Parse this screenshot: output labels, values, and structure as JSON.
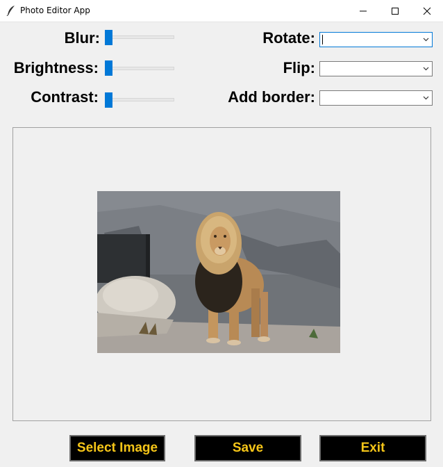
{
  "window": {
    "title": "Photo Editor App",
    "icons": {
      "app": "feather-icon",
      "minimize": "minimize-icon",
      "maximize": "maximize-icon",
      "close": "close-icon"
    }
  },
  "sliders": [
    {
      "label": "Blur:",
      "value": 0
    },
    {
      "label": "Brightness:",
      "value": 0
    },
    {
      "label": "Contrast:",
      "value": 0
    }
  ],
  "combos": [
    {
      "label": "Rotate:",
      "value": ""
    },
    {
      "label": "Flip:",
      "value": ""
    },
    {
      "label": "Add border:",
      "value": ""
    }
  ],
  "image": {
    "subject": "lion-photo"
  },
  "buttons": {
    "select_image": "Select Image",
    "save": "Save",
    "exit": "Exit"
  },
  "colors": {
    "accent": "#0078d7",
    "button_bg": "#000000",
    "button_text": "#f5c518",
    "background": "#f0f0f0"
  }
}
